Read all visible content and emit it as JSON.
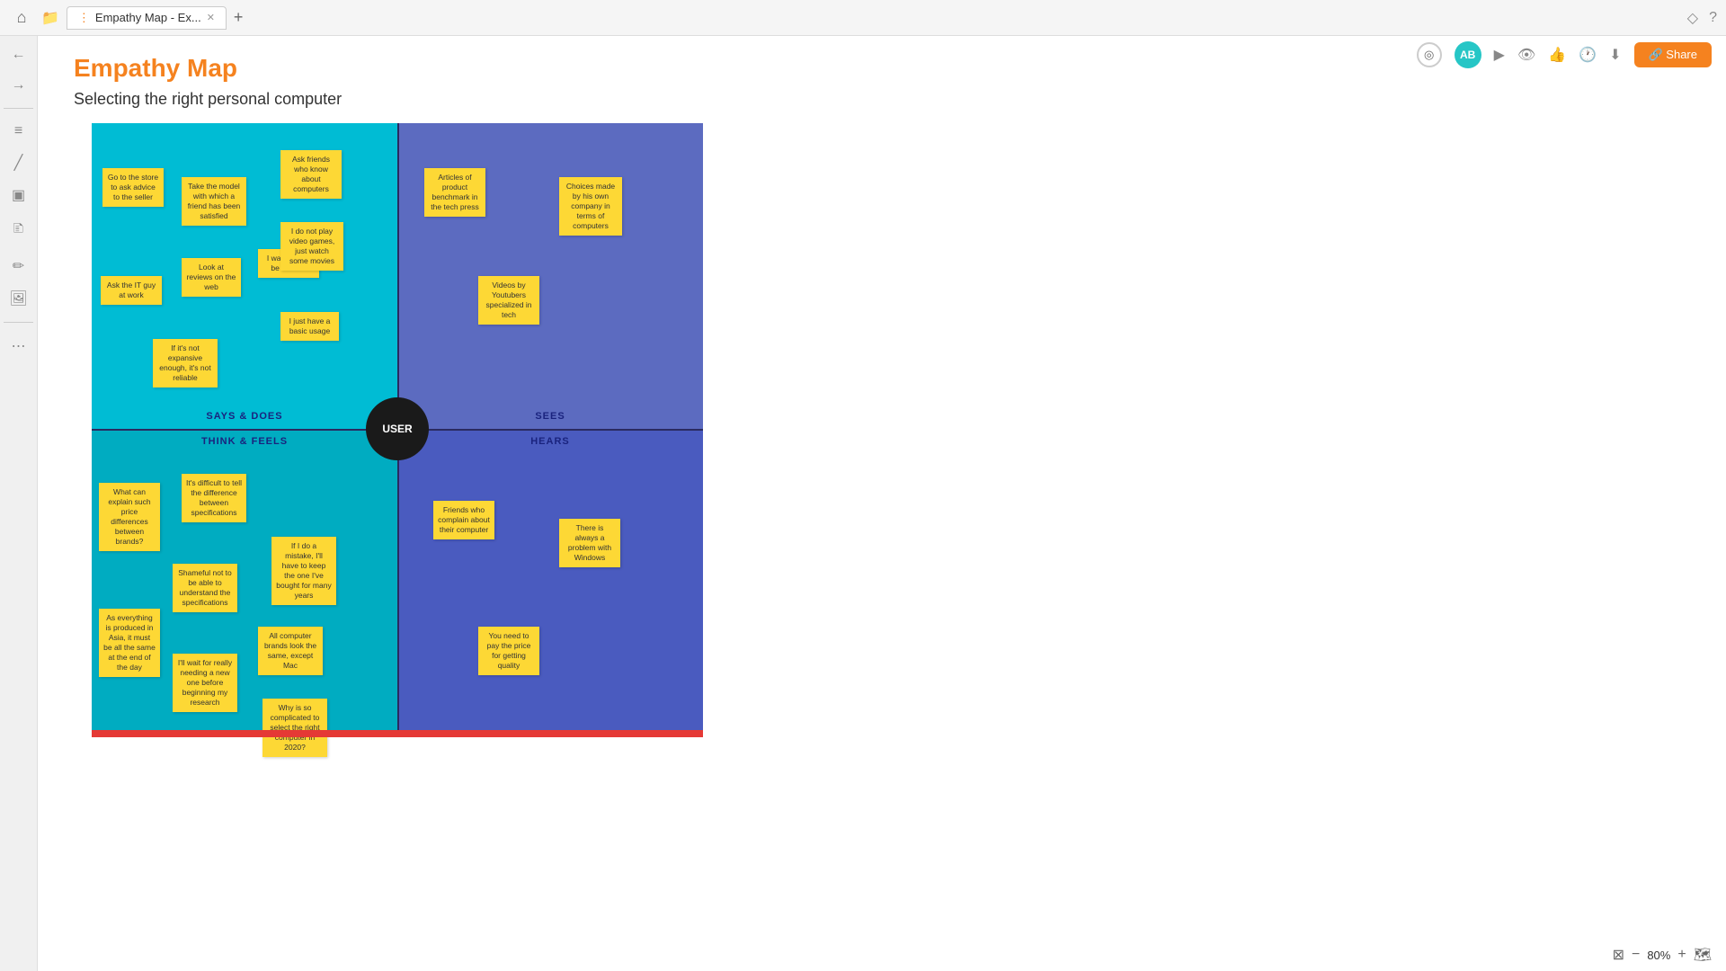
{
  "topbar": {
    "tab_label": "Empathy Map - Ex...",
    "share_label": "🔗 Share"
  },
  "toolbar": {
    "avatar": "AB",
    "zoom": "80%"
  },
  "page": {
    "title": "Empathy Map",
    "subtitle": "Selecting the right personal computer",
    "user_label": "USER"
  },
  "quadrants": {
    "says_does": "SAYS & DOES",
    "sees": "SEES",
    "thinks_feels": "THINK & FEELS",
    "hears": "HEARS"
  },
  "sticky_notes": {
    "says_does": [
      {
        "id": "s1",
        "text": "Go to the store to ask advice to the seller"
      },
      {
        "id": "s2",
        "text": "Take the model with which a friend has been satisfied"
      },
      {
        "id": "s3",
        "text": "Ask friends who know about computers"
      },
      {
        "id": "s4",
        "text": "Look at reviews on the web"
      },
      {
        "id": "s5",
        "text": "Ask the IT guy at work"
      },
      {
        "id": "s6",
        "text": "I want to it to be reliable"
      },
      {
        "id": "s7",
        "text": "If it's not expansive enough, it's not reliable"
      },
      {
        "id": "s8",
        "text": "I do not play video games, just watch some movies"
      },
      {
        "id": "s9",
        "text": "I just have a basic usage"
      }
    ],
    "sees": [
      {
        "id": "se1",
        "text": "Articles of product benchmark in the tech press"
      },
      {
        "id": "se2",
        "text": "Choices made by his own company in terms of computers"
      },
      {
        "id": "se3",
        "text": "Videos by Youtubers specialized in tech"
      }
    ],
    "thinks_feels": [
      {
        "id": "t1",
        "text": "What can explain such price differences between brands?"
      },
      {
        "id": "t2",
        "text": "It's difficult to tell the difference between specifications"
      },
      {
        "id": "t3",
        "text": "Shameful not to be able to understand the specifications"
      },
      {
        "id": "t4",
        "text": "As everything is produced in Asia, it must be all the same at the end of the day"
      },
      {
        "id": "t5",
        "text": "I'll wait for really needing a new one before beginning my research"
      },
      {
        "id": "t6",
        "text": "If I do a mistake, I'll have to keep the one I've bought for many years"
      },
      {
        "id": "t7",
        "text": "All computer brands look the same, except Mac"
      },
      {
        "id": "t8",
        "text": "Why is so complicated to select the right computer in 2020?"
      }
    ],
    "hears": [
      {
        "id": "h1",
        "text": "Friends who complain about their computer"
      },
      {
        "id": "h2",
        "text": "There is always a problem with Windows"
      },
      {
        "id": "h3",
        "text": "You need to pay the price for getting quality"
      }
    ]
  },
  "bottom": {
    "zoom_out": "−",
    "zoom_in": "+",
    "zoom_level": "80%",
    "fit_icon": "⊠",
    "map_icon": "🗺"
  }
}
